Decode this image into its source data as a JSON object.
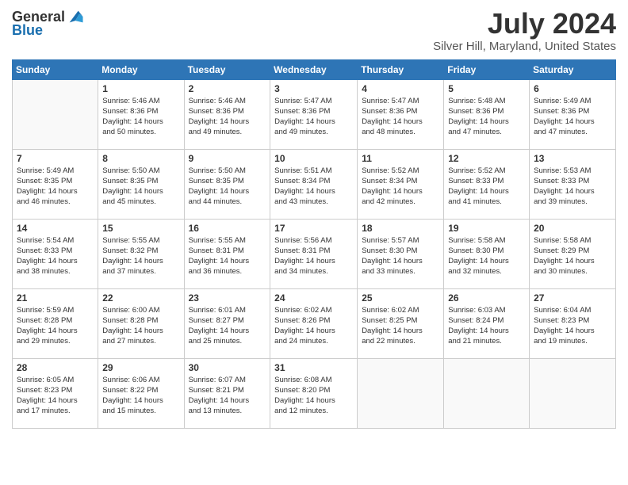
{
  "header": {
    "logo_general": "General",
    "logo_blue": "Blue",
    "month": "July 2024",
    "location": "Silver Hill, Maryland, United States"
  },
  "weekdays": [
    "Sunday",
    "Monday",
    "Tuesday",
    "Wednesday",
    "Thursday",
    "Friday",
    "Saturday"
  ],
  "weeks": [
    [
      {
        "day": "",
        "sunrise": "",
        "sunset": "",
        "daylight": ""
      },
      {
        "day": "1",
        "sunrise": "Sunrise: 5:46 AM",
        "sunset": "Sunset: 8:36 PM",
        "daylight": "Daylight: 14 hours and 50 minutes."
      },
      {
        "day": "2",
        "sunrise": "Sunrise: 5:46 AM",
        "sunset": "Sunset: 8:36 PM",
        "daylight": "Daylight: 14 hours and 49 minutes."
      },
      {
        "day": "3",
        "sunrise": "Sunrise: 5:47 AM",
        "sunset": "Sunset: 8:36 PM",
        "daylight": "Daylight: 14 hours and 49 minutes."
      },
      {
        "day": "4",
        "sunrise": "Sunrise: 5:47 AM",
        "sunset": "Sunset: 8:36 PM",
        "daylight": "Daylight: 14 hours and 48 minutes."
      },
      {
        "day": "5",
        "sunrise": "Sunrise: 5:48 AM",
        "sunset": "Sunset: 8:36 PM",
        "daylight": "Daylight: 14 hours and 47 minutes."
      },
      {
        "day": "6",
        "sunrise": "Sunrise: 5:49 AM",
        "sunset": "Sunset: 8:36 PM",
        "daylight": "Daylight: 14 hours and 47 minutes."
      }
    ],
    [
      {
        "day": "7",
        "sunrise": "Sunrise: 5:49 AM",
        "sunset": "Sunset: 8:35 PM",
        "daylight": "Daylight: 14 hours and 46 minutes."
      },
      {
        "day": "8",
        "sunrise": "Sunrise: 5:50 AM",
        "sunset": "Sunset: 8:35 PM",
        "daylight": "Daylight: 14 hours and 45 minutes."
      },
      {
        "day": "9",
        "sunrise": "Sunrise: 5:50 AM",
        "sunset": "Sunset: 8:35 PM",
        "daylight": "Daylight: 14 hours and 44 minutes."
      },
      {
        "day": "10",
        "sunrise": "Sunrise: 5:51 AM",
        "sunset": "Sunset: 8:34 PM",
        "daylight": "Daylight: 14 hours and 43 minutes."
      },
      {
        "day": "11",
        "sunrise": "Sunrise: 5:52 AM",
        "sunset": "Sunset: 8:34 PM",
        "daylight": "Daylight: 14 hours and 42 minutes."
      },
      {
        "day": "12",
        "sunrise": "Sunrise: 5:52 AM",
        "sunset": "Sunset: 8:33 PM",
        "daylight": "Daylight: 14 hours and 41 minutes."
      },
      {
        "day": "13",
        "sunrise": "Sunrise: 5:53 AM",
        "sunset": "Sunset: 8:33 PM",
        "daylight": "Daylight: 14 hours and 39 minutes."
      }
    ],
    [
      {
        "day": "14",
        "sunrise": "Sunrise: 5:54 AM",
        "sunset": "Sunset: 8:33 PM",
        "daylight": "Daylight: 14 hours and 38 minutes."
      },
      {
        "day": "15",
        "sunrise": "Sunrise: 5:55 AM",
        "sunset": "Sunset: 8:32 PM",
        "daylight": "Daylight: 14 hours and 37 minutes."
      },
      {
        "day": "16",
        "sunrise": "Sunrise: 5:55 AM",
        "sunset": "Sunset: 8:31 PM",
        "daylight": "Daylight: 14 hours and 36 minutes."
      },
      {
        "day": "17",
        "sunrise": "Sunrise: 5:56 AM",
        "sunset": "Sunset: 8:31 PM",
        "daylight": "Daylight: 14 hours and 34 minutes."
      },
      {
        "day": "18",
        "sunrise": "Sunrise: 5:57 AM",
        "sunset": "Sunset: 8:30 PM",
        "daylight": "Daylight: 14 hours and 33 minutes."
      },
      {
        "day": "19",
        "sunrise": "Sunrise: 5:58 AM",
        "sunset": "Sunset: 8:30 PM",
        "daylight": "Daylight: 14 hours and 32 minutes."
      },
      {
        "day": "20",
        "sunrise": "Sunrise: 5:58 AM",
        "sunset": "Sunset: 8:29 PM",
        "daylight": "Daylight: 14 hours and 30 minutes."
      }
    ],
    [
      {
        "day": "21",
        "sunrise": "Sunrise: 5:59 AM",
        "sunset": "Sunset: 8:28 PM",
        "daylight": "Daylight: 14 hours and 29 minutes."
      },
      {
        "day": "22",
        "sunrise": "Sunrise: 6:00 AM",
        "sunset": "Sunset: 8:28 PM",
        "daylight": "Daylight: 14 hours and 27 minutes."
      },
      {
        "day": "23",
        "sunrise": "Sunrise: 6:01 AM",
        "sunset": "Sunset: 8:27 PM",
        "daylight": "Daylight: 14 hours and 25 minutes."
      },
      {
        "day": "24",
        "sunrise": "Sunrise: 6:02 AM",
        "sunset": "Sunset: 8:26 PM",
        "daylight": "Daylight: 14 hours and 24 minutes."
      },
      {
        "day": "25",
        "sunrise": "Sunrise: 6:02 AM",
        "sunset": "Sunset: 8:25 PM",
        "daylight": "Daylight: 14 hours and 22 minutes."
      },
      {
        "day": "26",
        "sunrise": "Sunrise: 6:03 AM",
        "sunset": "Sunset: 8:24 PM",
        "daylight": "Daylight: 14 hours and 21 minutes."
      },
      {
        "day": "27",
        "sunrise": "Sunrise: 6:04 AM",
        "sunset": "Sunset: 8:23 PM",
        "daylight": "Daylight: 14 hours and 19 minutes."
      }
    ],
    [
      {
        "day": "28",
        "sunrise": "Sunrise: 6:05 AM",
        "sunset": "Sunset: 8:23 PM",
        "daylight": "Daylight: 14 hours and 17 minutes."
      },
      {
        "day": "29",
        "sunrise": "Sunrise: 6:06 AM",
        "sunset": "Sunset: 8:22 PM",
        "daylight": "Daylight: 14 hours and 15 minutes."
      },
      {
        "day": "30",
        "sunrise": "Sunrise: 6:07 AM",
        "sunset": "Sunset: 8:21 PM",
        "daylight": "Daylight: 14 hours and 13 minutes."
      },
      {
        "day": "31",
        "sunrise": "Sunrise: 6:08 AM",
        "sunset": "Sunset: 8:20 PM",
        "daylight": "Daylight: 14 hours and 12 minutes."
      },
      {
        "day": "",
        "sunrise": "",
        "sunset": "",
        "daylight": ""
      },
      {
        "day": "",
        "sunrise": "",
        "sunset": "",
        "daylight": ""
      },
      {
        "day": "",
        "sunrise": "",
        "sunset": "",
        "daylight": ""
      }
    ]
  ]
}
